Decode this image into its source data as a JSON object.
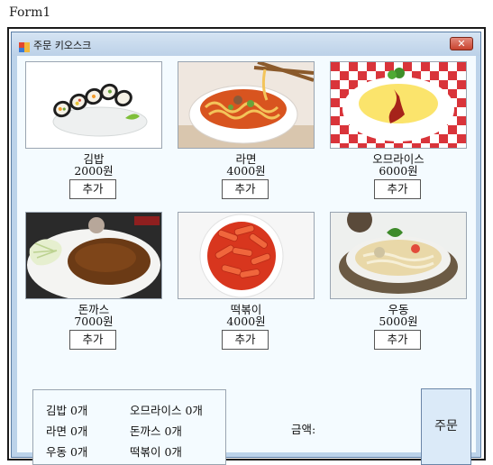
{
  "outer_caption": "Form1",
  "window": {
    "title": "주문 키오스크",
    "close_symbol": "✕"
  },
  "menu": [
    {
      "name": "김밥",
      "price": "2000원",
      "button": "추가",
      "image": "gimbap-photo"
    },
    {
      "name": "라면",
      "price": "4000원",
      "button": "추가",
      "image": "ramen-photo"
    },
    {
      "name": "오므라이스",
      "price": "6000원",
      "button": "추가",
      "image": "omurice-photo"
    },
    {
      "name": "돈까스",
      "price": "7000원",
      "button": "추가",
      "image": "donkatsu-photo"
    },
    {
      "name": "떡볶이",
      "price": "4000원",
      "button": "추가",
      "image": "tteokbokki-photo"
    },
    {
      "name": "우동",
      "price": "5000원",
      "button": "추가",
      "image": "udon-photo"
    }
  ],
  "summary": {
    "col1": [
      "김밥 0개",
      "라면 0개",
      "우동 0개"
    ],
    "col2": [
      "오므라이스 0개",
      "돈까스 0개",
      "떡볶이 0개"
    ]
  },
  "amount_label": "금액:",
  "order_button": "주문",
  "colors": {
    "client_bg": "#f4fbff",
    "frame": "#bcd3ea",
    "order_button_bg": "#dbeaf8"
  }
}
